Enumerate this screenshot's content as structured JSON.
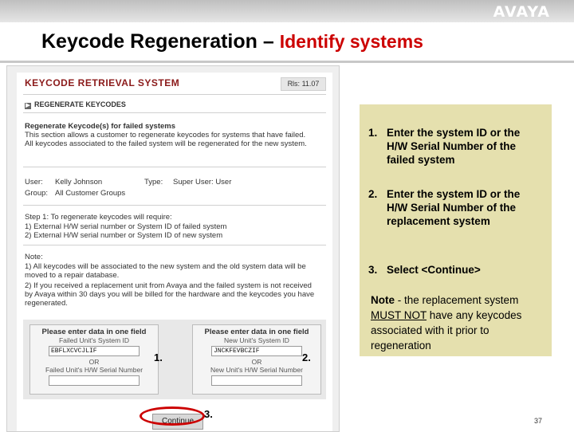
{
  "brand": "AVAYA",
  "slide": {
    "title": "Keycode Regeneration –",
    "subtitle": "Identify systems",
    "page_number": "37"
  },
  "app": {
    "title": "KEYCODE RETRIEVAL SYSTEM",
    "release": "Rls: 11.07",
    "nav": "REGENERATE KEYCODES",
    "section_title": "Regenerate Keycode(s) for failed systems",
    "desc_line1": "This section allows a customer to regenerate keycodes for systems that have failed.",
    "desc_line2": "All keycodes associated to the failed system will be regenerated for the new system.",
    "user_label": "User:",
    "user_value": "Kelly Johnson",
    "type_label": "Type:",
    "type_value": "Super User: User",
    "group_label": "Group:",
    "group_value": "All Customer Groups",
    "step1_heading": "Step 1: To regenerate keycodes will require:",
    "step1_item1": "1) External H/W serial number or System ID of failed system",
    "step1_item2": "2) External H/W serial number or System ID of new system",
    "note_label": "Note:",
    "note1_line1": "1) All keycodes will be associated to the new system and the old system data will be",
    "note1_line2": "moved to a repair database.",
    "note2_line1": "2) If you received a replacement unit from Avaya and the failed system is not received",
    "note2_line2": "by Avaya within 30 days you will be billed for the hardware and the keycodes you have",
    "note2_line3": "regenerated.",
    "form_left": {
      "heading": "Please enter data in one field",
      "id_label": "Failed Unit's System ID",
      "id_value": "EBFLXCVCJLIF",
      "or": "OR",
      "serial_label": "Failed Unit's H/W Serial Number",
      "serial_value": ""
    },
    "form_right": {
      "heading": "Please enter data in one field",
      "id_label": "New Unit's System ID",
      "id_value": "JNCKFEVBCZIF",
      "or": "OR",
      "serial_label": "New Unit's H/W Serial Number",
      "serial_value": ""
    },
    "continue_label": "Continue"
  },
  "callouts": {
    "c1": "1.",
    "c2": "2.",
    "c3": "3."
  },
  "instructions": {
    "steps": [
      {
        "num": "1.",
        "text": "Enter the system ID or the H/W Serial Number of the failed system"
      },
      {
        "num": "2.",
        "text": "Enter the system ID or the H/W Serial Number of the replacement system"
      },
      {
        "num": "3.",
        "text": "Select <Continue>"
      }
    ],
    "note_label": "Note",
    "note_prefix": " - the replacement system ",
    "note_emphasis": "MUST NOT",
    "note_suffix": " have any keycodes associated with it prior to regeneration"
  },
  "colors": {
    "title_accent": "#cc0000",
    "app_title": "#8b1a1a",
    "note_bg": "#e5e0ae",
    "callout_ring": "#cc0000"
  }
}
